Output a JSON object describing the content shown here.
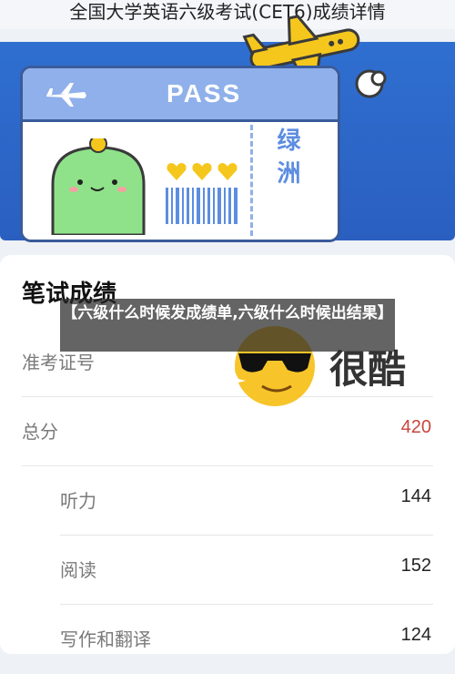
{
  "page": {
    "title": "全国大学英语六级考试(CET6)成绩详情"
  },
  "ticket": {
    "pass_text": "PASS",
    "stub_text": "绿洲"
  },
  "overlay": {
    "caption": "【六级什么时候发成绩单,六级什么时候出结果】"
  },
  "sticker": {
    "text": "很酷"
  },
  "scores": {
    "section_title": "笔试成绩",
    "rows": [
      {
        "label": "准考证号",
        "value": ""
      },
      {
        "label": "总分",
        "value": "420",
        "value_color": "#c8453e"
      },
      {
        "label": "听力",
        "value": "144"
      },
      {
        "label": "阅读",
        "value": "152"
      },
      {
        "label": "写作和翻译",
        "value": "124"
      }
    ]
  },
  "colors": {
    "hero_blue": "#2f6fd0",
    "ticket_top": "#8fb0ea",
    "total_red": "#c8453e",
    "yellow": "#f5c71d"
  },
  "icons": [
    "plane-icon",
    "cactus-icon",
    "heart-icon",
    "barcode-icon",
    "cool-emoji-icon"
  ]
}
